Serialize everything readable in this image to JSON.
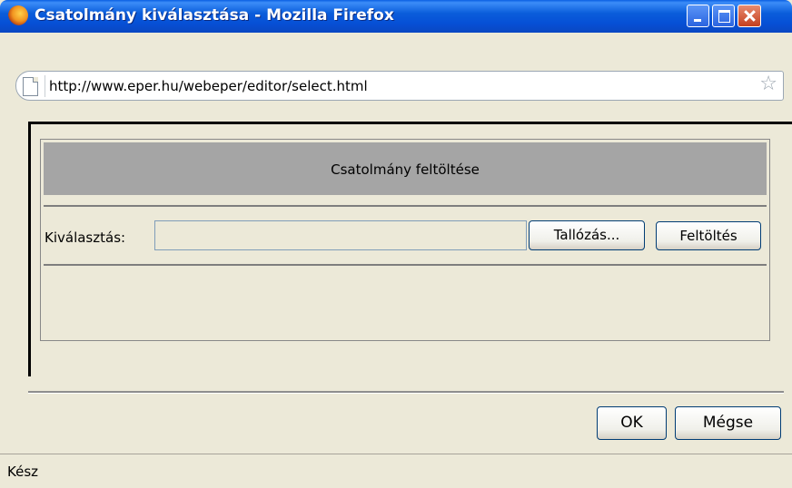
{
  "window": {
    "title": "Csatolmány kiválasztása - Mozilla Firefox"
  },
  "urlbar": {
    "url": "http://www.eper.hu/webeper/editor/select.html"
  },
  "dialog": {
    "header": "Csatolmány feltöltése",
    "select_label": "Kiválasztás:",
    "file_value": "",
    "browse_label": "Tallózás...",
    "upload_label": "Feltöltés",
    "ok_label": "OK",
    "cancel_label": "Mégse"
  },
  "status": {
    "text": "Kész"
  },
  "icons": {
    "app": "firefox-icon",
    "page": "page-icon",
    "bookmark": "star-icon"
  }
}
